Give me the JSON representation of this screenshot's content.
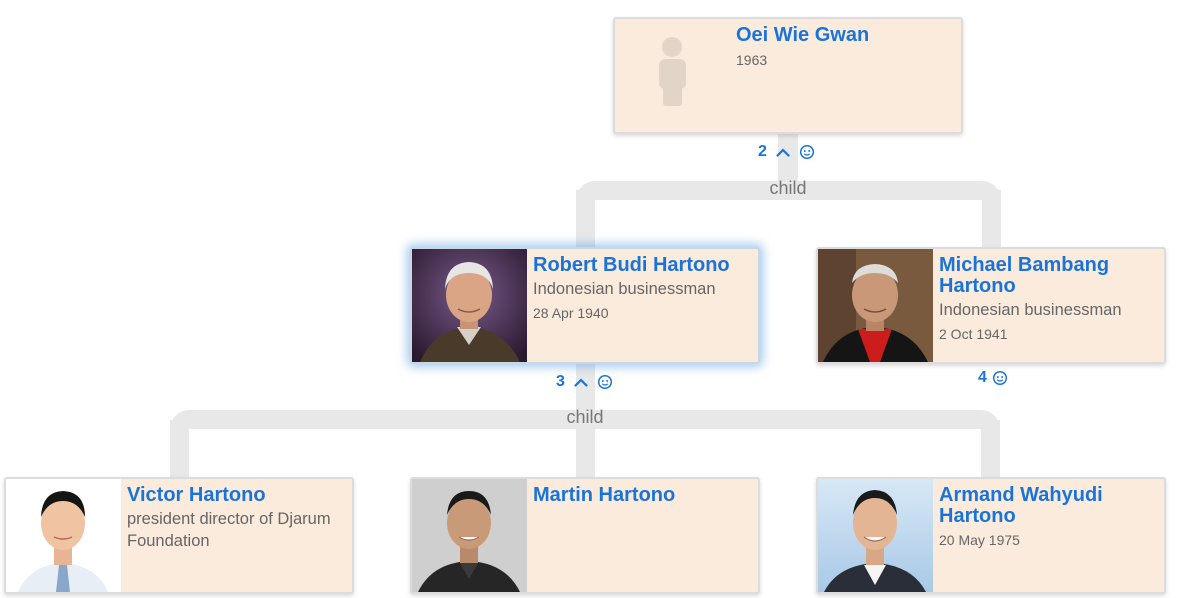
{
  "relation_label": "child",
  "colors": {
    "accent": "#1a73d9",
    "card_bg": "#faebdd",
    "connector": "#e8e8e8"
  },
  "people": {
    "oei": {
      "name": "Oei Wie Gwan",
      "date": "1963"
    },
    "robert": {
      "name": "Robert Budi Hartono",
      "description": "Indonesian businessman",
      "date": "28 Apr 1940"
    },
    "michael": {
      "name": "Michael Bambang Hartono",
      "description": "Indonesian businessman",
      "date": "2 Oct 1941"
    },
    "victor": {
      "name": "Victor Hartono",
      "description": "president director of Djarum Foundation"
    },
    "martin": {
      "name": "Martin Hartono"
    },
    "armand": {
      "name": "Armand Wahyudi Hartono",
      "date": "20 May 1975"
    }
  },
  "controls": {
    "oei": {
      "count": "2",
      "icons": [
        "collapse-up-icon",
        "children-face-icon"
      ]
    },
    "robert": {
      "count": "3",
      "icons": [
        "collapse-up-icon",
        "children-face-icon"
      ]
    },
    "michael": {
      "count": "4",
      "icons": [
        "children-face-icon"
      ]
    }
  }
}
